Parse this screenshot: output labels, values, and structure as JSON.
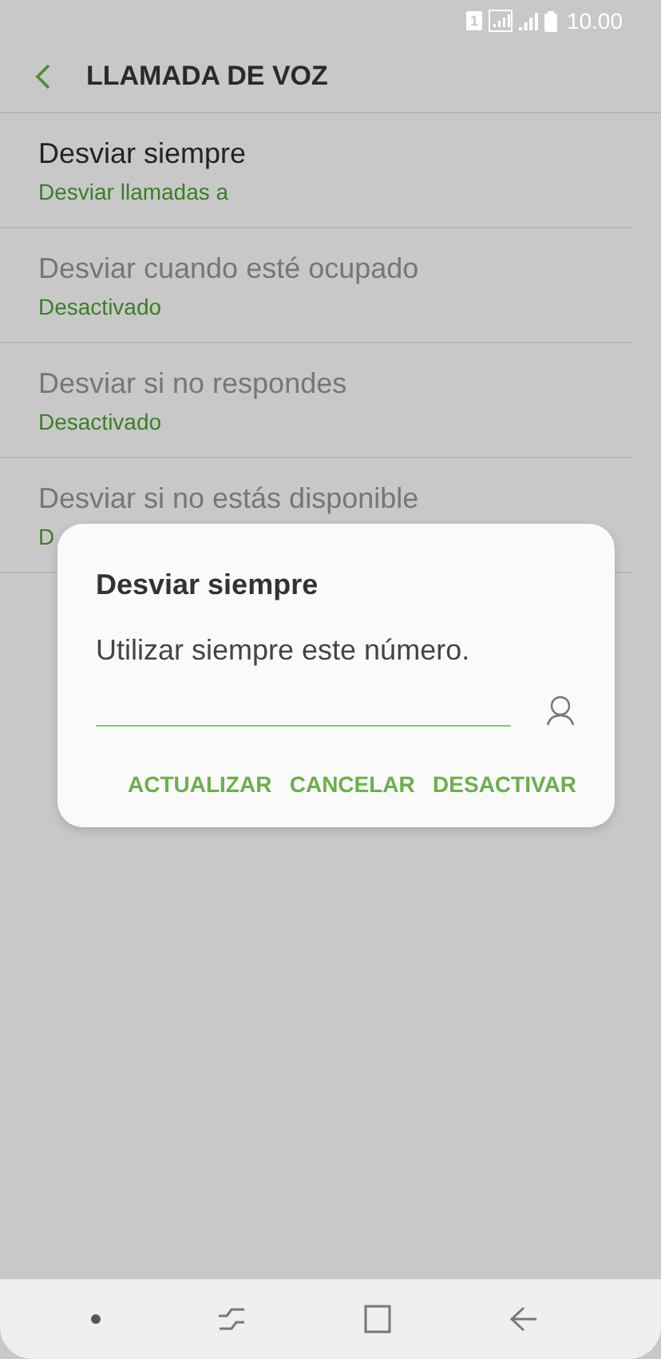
{
  "status_bar": {
    "sim": "1",
    "time": "10.00"
  },
  "header": {
    "title": "LLAMADA DE VOZ"
  },
  "items": [
    {
      "title": "Desviar siempre",
      "subtitle": "Desviar llamadas a",
      "disabled": false
    },
    {
      "title": "Desviar cuando esté ocupado",
      "subtitle": "Desactivado",
      "disabled": true
    },
    {
      "title": "Desviar si no respondes",
      "subtitle": "Desactivado",
      "disabled": true
    },
    {
      "title": "Desviar si no estás disponible",
      "subtitle": "D",
      "disabled": true
    }
  ],
  "dialog": {
    "title": "Desviar siempre",
    "message": "Utilizar siempre este número.",
    "buttons": [
      "ACTUALIZAR",
      "CANCELAR",
      "DESACTIVAR"
    ]
  }
}
